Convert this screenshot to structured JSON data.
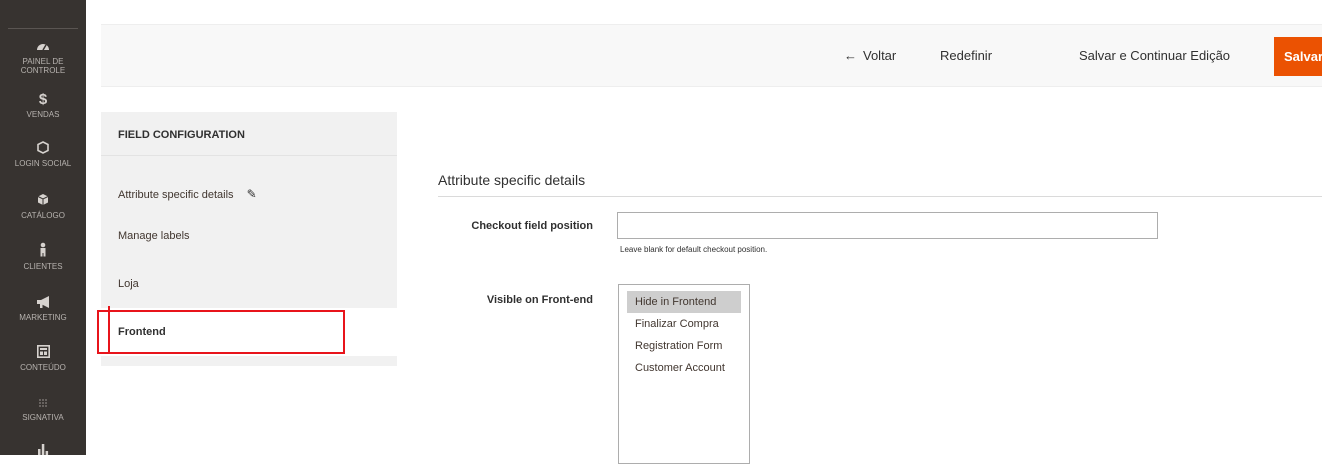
{
  "sidebar": {
    "items": [
      {
        "icon": "dashboard-icon",
        "label": "PAINEL DE CONTROLE"
      },
      {
        "icon": "dollar-icon",
        "label": "VENDAS"
      },
      {
        "icon": "hexagon-icon",
        "label": "LOGIN SOCIAL"
      },
      {
        "icon": "cube-icon",
        "label": "CATÁLOGO"
      },
      {
        "icon": "person-icon",
        "label": "CLIENTES"
      },
      {
        "icon": "megaphone-icon",
        "label": "MARKETING"
      },
      {
        "icon": "layout-icon",
        "label": "CONTEÚDO"
      },
      {
        "icon": "dots-icon",
        "label": "SIGNATIVA"
      },
      {
        "icon": "bar-chart-icon",
        "label": ""
      }
    ]
  },
  "actions": {
    "back": "Voltar",
    "reset": "Redefinir",
    "save_continue": "Salvar e Continuar Edição",
    "save": "Salvar"
  },
  "tabs": {
    "title": "FIELD CONFIGURATION",
    "items": [
      {
        "label": "Attribute specific details"
      },
      {
        "label": "Manage labels"
      },
      {
        "label": "Loja"
      },
      {
        "label": "Frontend"
      }
    ]
  },
  "section": {
    "title": "Attribute specific details",
    "checkout_position": {
      "label": "Checkout field position",
      "value": "",
      "note": "Leave blank for default checkout position."
    },
    "visible": {
      "label": "Visible on Front-end",
      "options": [
        "Hide in Frontend",
        "Finalizar Compra",
        "Registration Form",
        "Customer Account"
      ],
      "selected": "Hide in Frontend"
    }
  },
  "colors": {
    "sidebar_bg": "#373330",
    "save_orange": "#eb5202",
    "highlight_red": "#e8141b"
  }
}
